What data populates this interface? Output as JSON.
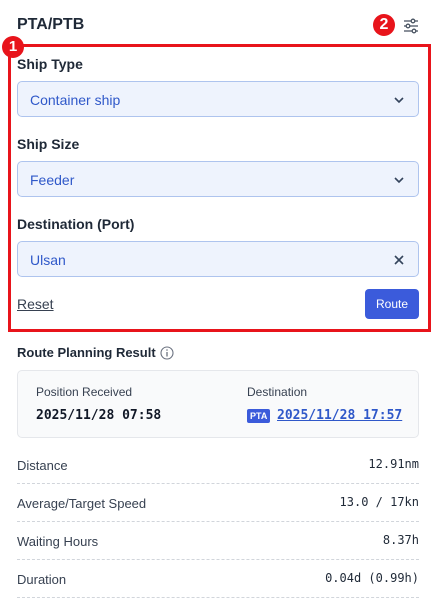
{
  "header": {
    "title": "PTA/PTB",
    "badge": "2"
  },
  "form": {
    "badge": "1",
    "ship_type": {
      "label": "Ship Type",
      "value": "Container ship"
    },
    "ship_size": {
      "label": "Ship Size",
      "value": "Feeder"
    },
    "destination": {
      "label": "Destination (Port)",
      "value": "Ulsan"
    },
    "reset_label": "Reset",
    "route_label": "Route"
  },
  "result": {
    "title": "Route Planning Result",
    "position_received_label": "Position Received",
    "position_received_value": "2025/11/28 07:58",
    "destination_label": "Destination",
    "destination_tag": "PTA",
    "destination_value": "2025/11/28 17:57",
    "rows": [
      {
        "label": "Distance",
        "value": "12.91nm"
      },
      {
        "label": "Average/Target Speed",
        "value": "13.0 / 17kn"
      },
      {
        "label": "Waiting Hours",
        "value": "8.37h"
      },
      {
        "label": "Duration",
        "value": "0.04d (0.99h)"
      }
    ]
  },
  "colors": {
    "accent": "#3b5bdb",
    "highlight": "#e8141b",
    "field_bg": "#eef3fd"
  },
  "icons": [
    "settings-sliders-icon",
    "chevron-down-icon",
    "close-icon",
    "info-icon"
  ]
}
